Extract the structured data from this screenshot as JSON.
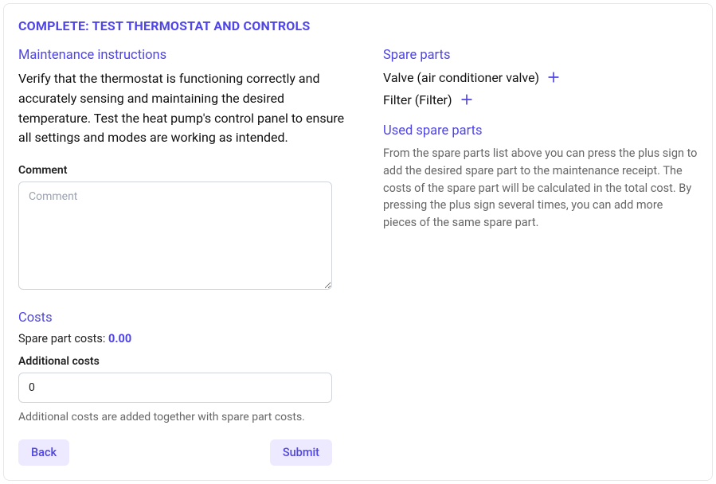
{
  "title": "COMPLETE: TEST THERMOSTAT AND CONTROLS",
  "left": {
    "instructions_heading": "Maintenance instructions",
    "instructions_text": "Verify that the thermostat is functioning correctly and accurately sensing and maintaining the desired temperature. Test the heat pump's control panel to ensure all settings and modes are working as intended.",
    "comment_label": "Comment",
    "comment_placeholder": "Comment",
    "comment_value": "",
    "costs_heading": "Costs",
    "spare_cost_label": "Spare part costs: ",
    "spare_cost_value": "0.00",
    "additional_costs_label": "Additional costs",
    "additional_costs_value": "0",
    "costs_helper": "Additional costs are added together with spare part costs.",
    "back_label": "Back",
    "submit_label": "Submit"
  },
  "right": {
    "spare_heading": "Spare parts",
    "items": [
      {
        "label": "Valve (air conditioner valve)"
      },
      {
        "label": "Filter (Filter)"
      }
    ],
    "used_heading": "Used spare parts",
    "used_text": "From the spare parts list above you can press the plus sign to add the desired spare part to the maintenance receipt. The costs of the spare part will be calculated in the total cost. By pressing the plus sign several times, you can add more pieces of the same spare part."
  }
}
